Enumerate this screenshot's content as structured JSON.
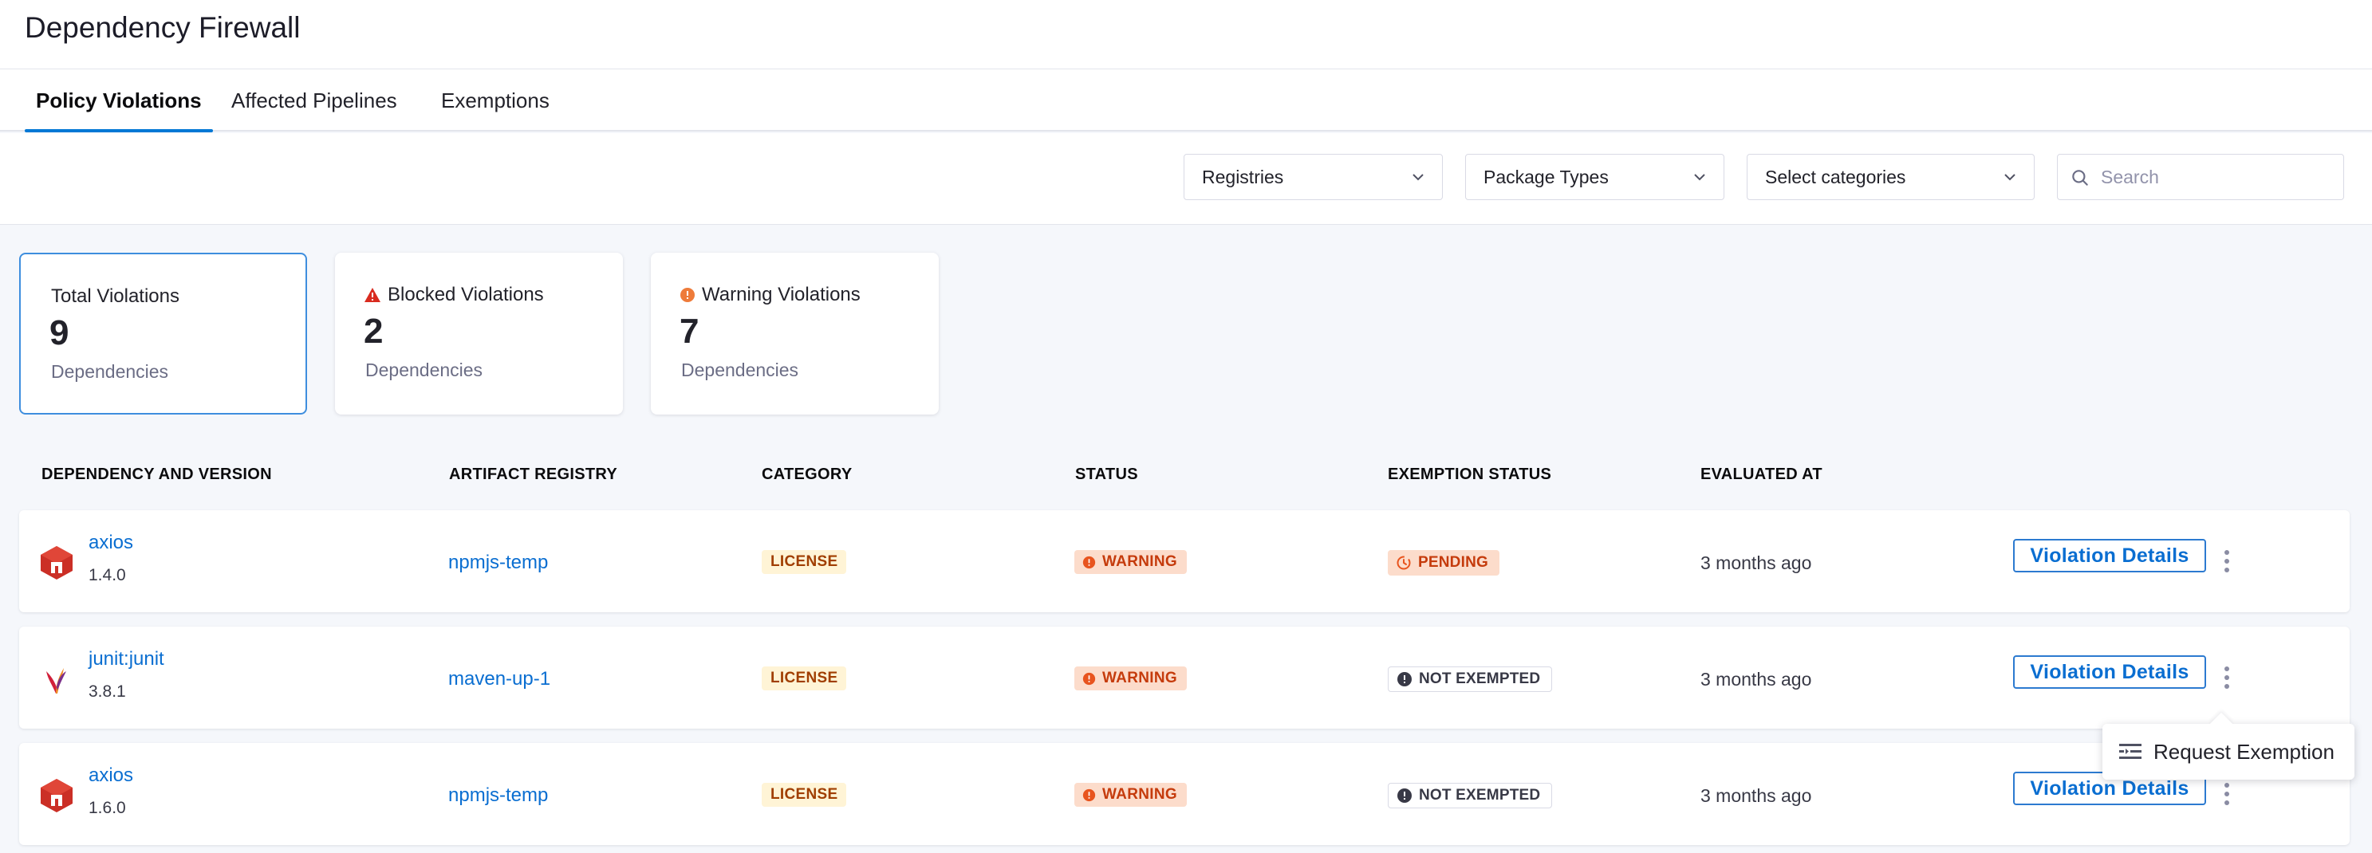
{
  "header": {
    "title": "Dependency Firewall"
  },
  "tabs": [
    {
      "label": "Policy Violations",
      "active": true
    },
    {
      "label": "Affected Pipelines",
      "active": false
    },
    {
      "label": "Exemptions",
      "active": false
    }
  ],
  "filters": {
    "registries": "Registries",
    "package_types": "Package Types",
    "categories": "Select categories",
    "search_placeholder": "Search"
  },
  "cards": [
    {
      "label": "Total Violations",
      "value": "9",
      "sub": "Dependencies",
      "icon": "none"
    },
    {
      "label": "Blocked Violations",
      "value": "2",
      "sub": "Dependencies",
      "icon": "warning-triangle-icon"
    },
    {
      "label": "Warning Violations",
      "value": "7",
      "sub": "Dependencies",
      "icon": "warning-circle-icon"
    }
  ],
  "table": {
    "columns": [
      "DEPENDENCY AND VERSION",
      "ARTIFACT REGISTRY",
      "CATEGORY",
      "STATUS",
      "EXEMPTION STATUS",
      "EVALUATED AT"
    ],
    "rows": [
      {
        "name": "axios",
        "version": "1.4.0",
        "icon": "npm-icon",
        "registry": "npmjs-temp",
        "category": "LICENSE",
        "status": "WARNING",
        "exemption": "PENDING",
        "evaluated": "3 months ago",
        "action": "Violation Details"
      },
      {
        "name": "junit:junit",
        "version": "3.8.1",
        "icon": "maven-icon",
        "registry": "maven-up-1",
        "category": "LICENSE",
        "status": "WARNING",
        "exemption": "NOT EXEMPTED",
        "evaluated": "3 months ago",
        "action": "Violation Details"
      },
      {
        "name": "axios",
        "version": "1.6.0",
        "icon": "npm-icon",
        "registry": "npmjs-temp",
        "category": "LICENSE",
        "status": "WARNING",
        "exemption": "NOT EXEMPTED",
        "evaluated": "3 months ago",
        "action": "Violation Details"
      }
    ]
  },
  "popover": {
    "label": "Request Exemption"
  },
  "colors": {
    "link": "#0a6ed1",
    "accent": "#0278d5",
    "warning_bg": "#fcdccb",
    "warning_text": "#c53b0c",
    "license_bg": "#fff4d6",
    "license_text": "#a03e00",
    "blocked_red": "#d92b1f"
  }
}
